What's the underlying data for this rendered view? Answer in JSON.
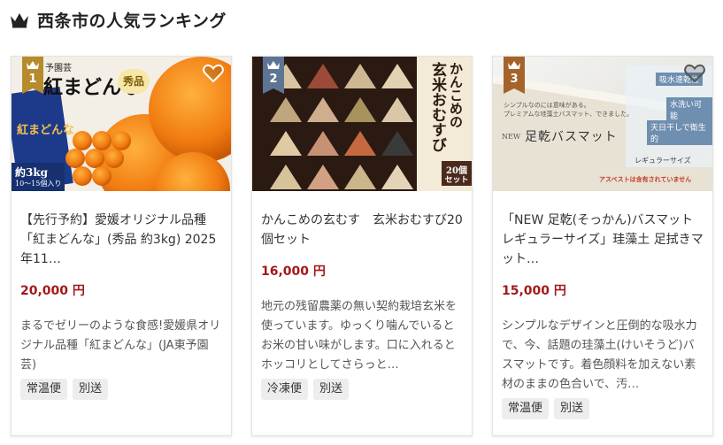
{
  "header": {
    "title": "西条市の人気ランキング"
  },
  "cards": [
    {
      "rank": "1",
      "rank_color": "#b68b2b",
      "image_text": {
        "brand": "予園芸",
        "title": "紅まどんな",
        "badge": "秀品",
        "box": "紅まどんな",
        "weight": "約3kg",
        "count": "10〜15個入り"
      },
      "name": "【先行予約】愛媛オリジナル品種「紅まどんな」(秀品 約3kg) 2025年11…",
      "price": "20,000 円",
      "desc": "まるでゼリーのような食感!愛媛県オリジナル品種「紅まどんな」(JA東予園芸)",
      "tags": [
        "常温便",
        "別送"
      ]
    },
    {
      "rank": "2",
      "rank_color": "#5d7593",
      "image_text": {
        "title1": "かんこめの",
        "title2": "玄米おむすび",
        "badge1": "20個",
        "badge2": "セット"
      },
      "name": "かんこめの玄むす　玄米おむすび20個セット",
      "price": "16,000 円",
      "desc": "地元の残留農薬の無い契約栽培玄米を使っています。ゆっくり噛んでいるとお米の甘い味がします。口に入れるとホッコリとしてさらっと…",
      "tags": [
        "冷凍便",
        "別送"
      ]
    },
    {
      "rank": "3",
      "rank_color": "#a5632a",
      "image_text": {
        "chip1": "吸水速乾性",
        "chip2": "水洗い可能",
        "chip3": "天日干しで衛生的",
        "lead1": "シンプルなのには意味がある。",
        "lead2": "プレミアムな珪藻土バスマット、できました。",
        "new": "NEW",
        "product": "足乾バスマット",
        "size": "レギュラーサイズ",
        "note": "アスベストは含有されていません"
      },
      "name": "「NEW 足乾(そっかん)バスマット レギュラーサイズ」珪藻土 足拭きマット…",
      "price": "15,000 円",
      "desc": "シンプルなデザインと圧倒的な吸水力で、今、話題の珪藻土(けいそうど)バスマットです。着色顔料を加えない素材のままの色合いで、汚…",
      "tags": [
        "常温便",
        "別送"
      ]
    }
  ]
}
